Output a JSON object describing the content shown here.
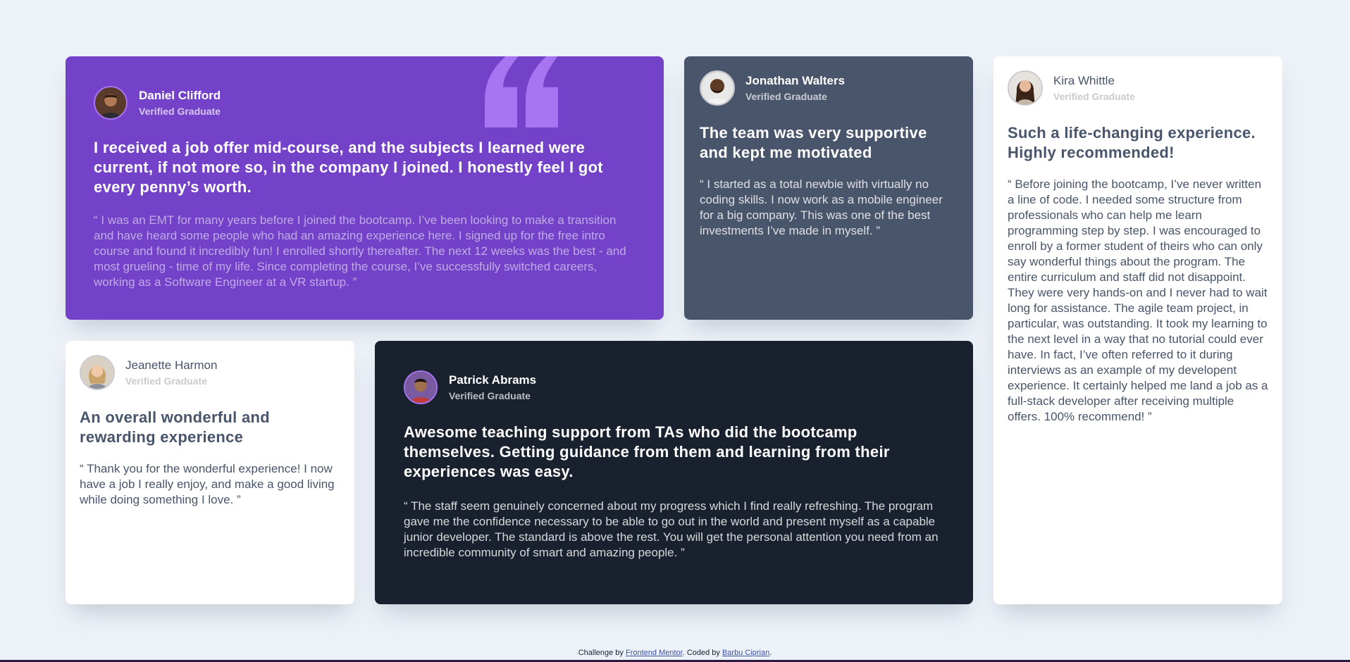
{
  "colors": {
    "background": "#edf2f8",
    "purple": "#7442c8",
    "slate": "#48556a",
    "dark": "#19212e",
    "white": "#ffffff",
    "quote_mark": "#a775f1"
  },
  "testimonials": [
    {
      "name": "Daniel Clifford",
      "role": "Verified Graduate",
      "avatar": "avatar-daniel",
      "headline": "I received a job offer mid-course, and the subjects I learned were current, if not more so, in the company I joined. I honestly feel I got every penny’s worth.",
      "body": "“ I was an EMT for many years before I joined the bootcamp. I’ve been looking to make a transition and have heard some people who had an amazing experience here. I signed up for the free intro course and found it incredibly fun! I enrolled shortly thereafter. The next 12 weeks was the best - and most grueling - time of my life. Since completing the course, I’ve successfully switched careers, working as a Software Engineer at a VR startup. ”"
    },
    {
      "name": "Jonathan Walters",
      "role": "Verified Graduate",
      "avatar": "avatar-jonathan",
      "headline": "The team was very supportive and kept me motivated",
      "body": "“ I started as a total newbie with virtually no coding skills. I now work as a mobile engineer for a big company. This was one of the best investments I’ve made in myself. ”"
    },
    {
      "name": "Kira Whittle",
      "role": "Verified Graduate",
      "avatar": "avatar-kira",
      "headline": "Such a life-changing experience. Highly recommended!",
      "body": "“ Before joining the bootcamp, I’ve never written a line of code. I needed some structure from professionals who can help me learn programming step by step. I was encouraged to enroll by a former student of theirs who can only say wonderful things about the program. The entire curriculum and staff did not disappoint. They were very hands-on and I never had to wait long for assistance. The agile team project, in particular, was outstanding. It took my learning to the next level in a way that no tutorial could ever have. In fact, I’ve often referred to it during interviews as an example of my developent experience. It certainly helped me land a job as a full-stack developer after receiving multiple offers. 100% recommend! ”"
    },
    {
      "name": "Jeanette Harmon",
      "role": "Verified Graduate",
      "avatar": "avatar-jeanette",
      "headline": "An overall wonderful and rewarding experience",
      "body": "“ Thank you for the wonderful experience! I now have a job I really enjoy, and make a good living while doing something I love. ”"
    },
    {
      "name": "Patrick Abrams",
      "role": "Verified Graduate",
      "avatar": "avatar-patrick",
      "headline": "Awesome teaching support from TAs who did the bootcamp themselves. Getting guidance from them and learning from their experiences was easy.",
      "body": "“ The staff seem genuinely concerned about my progress which I find really refreshing. The program gave me the confidence necessary to be able to go out in the world and present myself as a capable junior developer. The standard is above the rest. You will get the personal attention you need from an incredible community of smart and amazing people. ”"
    }
  ],
  "footer": {
    "prefix": "Challenge by ",
    "challenge_link": "Frontend Mentor",
    "middle": ". Coded by ",
    "author_link": "Barbu Ciprian",
    "suffix": "."
  }
}
